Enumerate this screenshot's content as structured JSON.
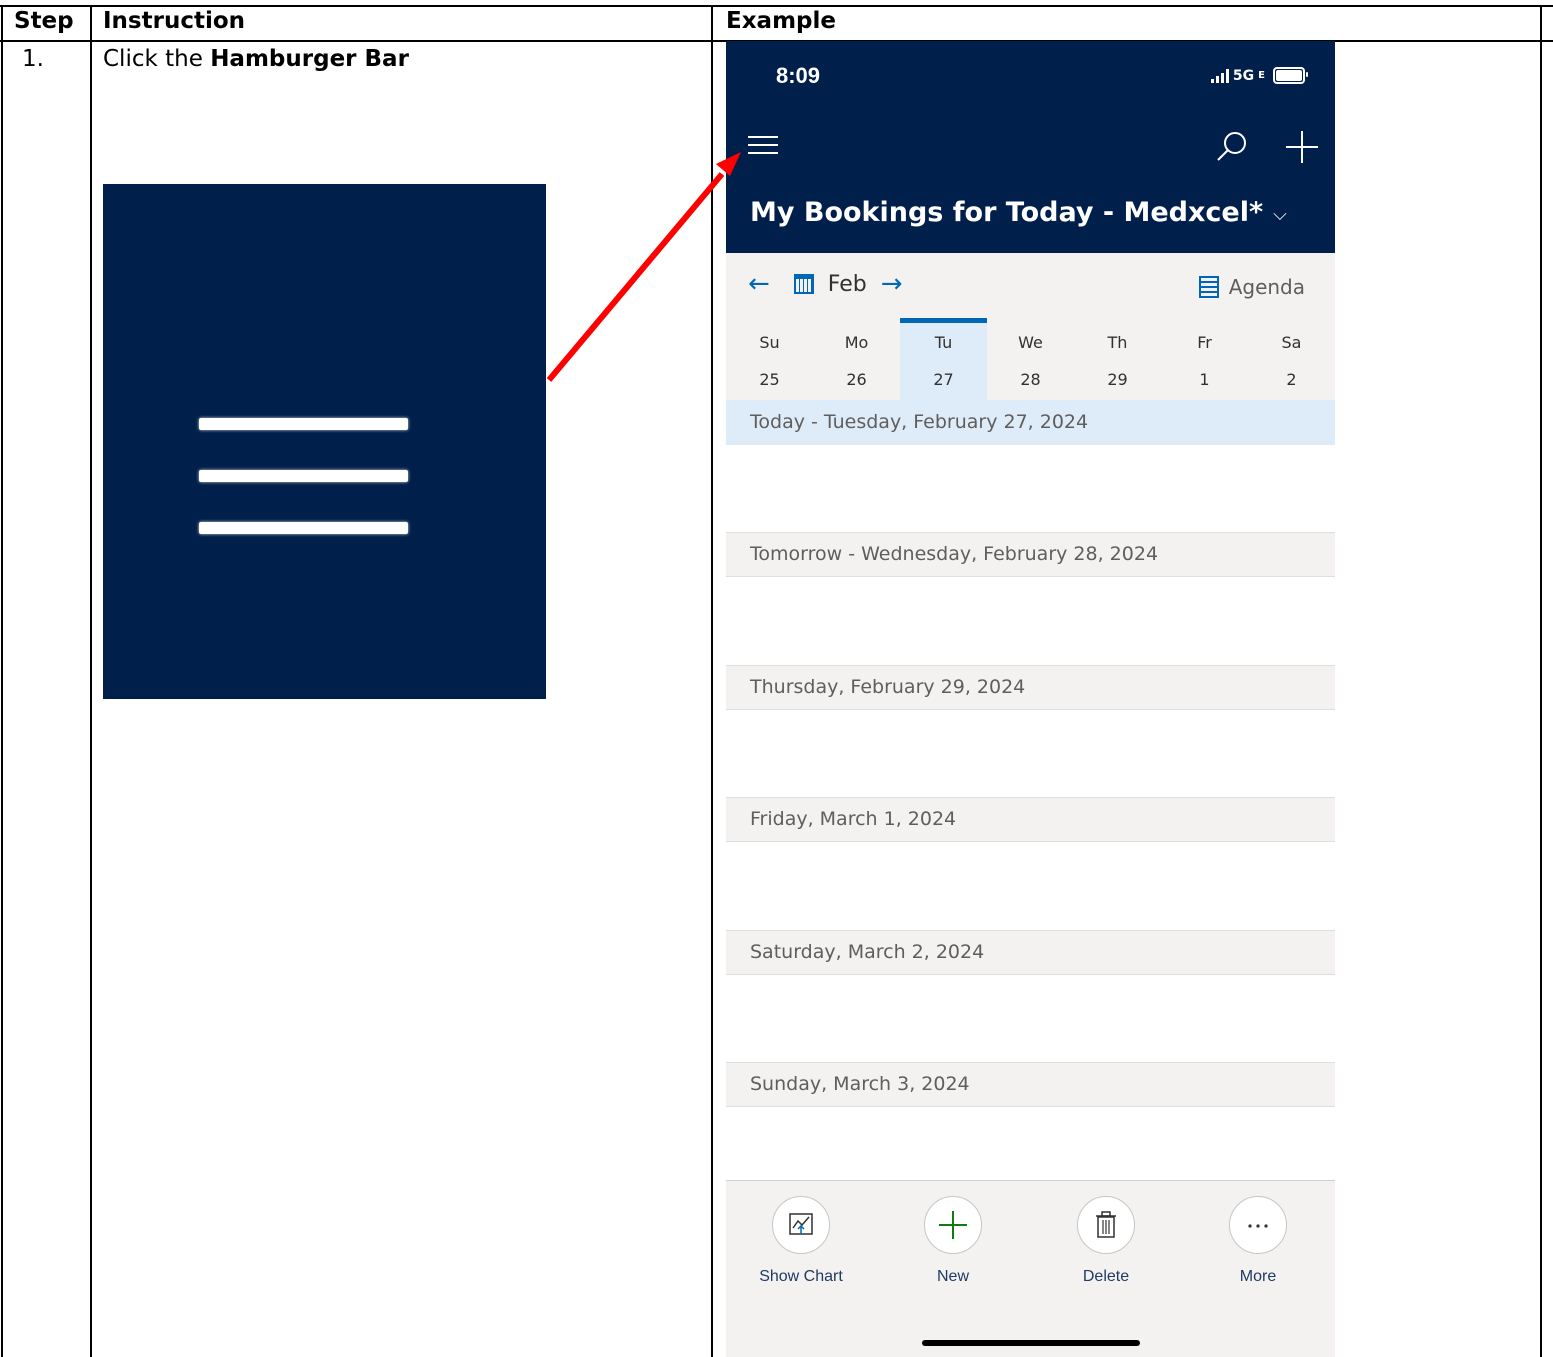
{
  "table": {
    "headers": {
      "step": "Step",
      "instruction": "Instruction",
      "example": "Example"
    },
    "row1": {
      "step": "1.",
      "instruction_prefix": "Click the ",
      "instruction_bold": "Hamburger Bar"
    }
  },
  "phone": {
    "status": {
      "time": "8:09",
      "network": "5G",
      "network_suffix": "E"
    },
    "title": "My Bookings for Today - Medxcel*",
    "title_chevron": "⌵",
    "nav": {
      "prev": "←",
      "month": "Feb",
      "next": "→",
      "view": "Agenda"
    },
    "week": [
      {
        "name": "Su",
        "date": "25"
      },
      {
        "name": "Mo",
        "date": "26"
      },
      {
        "name": "Tu",
        "date": "27",
        "selected": true
      },
      {
        "name": "We",
        "date": "28"
      },
      {
        "name": "Th",
        "date": "29"
      },
      {
        "name": "Fr",
        "date": "1"
      },
      {
        "name": "Sa",
        "date": "2"
      }
    ],
    "sections": [
      "Today - Tuesday, February 27, 2024",
      "Tomorrow - Wednesday, February 28, 2024",
      "Thursday, February 29, 2024",
      "Friday, March 1, 2024",
      "Saturday, March 2, 2024",
      "Sunday, March 3, 2024"
    ],
    "bottom": [
      {
        "label": "Show Chart",
        "icon": "chart-icon"
      },
      {
        "label": "New",
        "icon": "plus-icon"
      },
      {
        "label": "Delete",
        "icon": "trash-icon"
      },
      {
        "label": "More",
        "icon": "more-icon"
      }
    ]
  },
  "colors": {
    "header_navy": "#011f4b",
    "accent_blue": "#0067b8",
    "arrow_red": "#ff0000",
    "today_highlight": "#deecf9"
  }
}
